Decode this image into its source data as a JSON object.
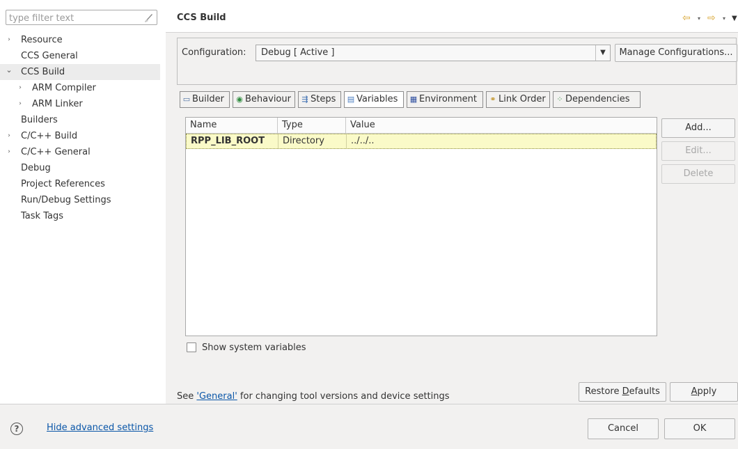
{
  "nav": {
    "filter_placeholder": "type filter text",
    "items": [
      {
        "label": "Resource",
        "expandable": true,
        "indent": 0
      },
      {
        "label": "CCS General",
        "expandable": false,
        "indent": 0
      },
      {
        "label": "CCS Build",
        "expandable": true,
        "expanded": true,
        "selected": true,
        "indent": 0
      },
      {
        "label": "ARM Compiler",
        "expandable": true,
        "indent": 1
      },
      {
        "label": "ARM Linker",
        "expandable": true,
        "indent": 1
      },
      {
        "label": "Builders",
        "expandable": false,
        "indent": 0
      },
      {
        "label": "C/C++ Build",
        "expandable": true,
        "indent": 0
      },
      {
        "label": "C/C++ General",
        "expandable": true,
        "indent": 0
      },
      {
        "label": "Debug",
        "expandable": false,
        "indent": 0
      },
      {
        "label": "Project References",
        "expandable": false,
        "indent": 0
      },
      {
        "label": "Run/Debug Settings",
        "expandable": false,
        "indent": 0
      },
      {
        "label": "Task Tags",
        "expandable": false,
        "indent": 0
      }
    ]
  },
  "header": {
    "title": "CCS Build"
  },
  "config": {
    "label": "Configuration:",
    "value": "Debug [ Active ]",
    "manage_label": "Manage Configurations..."
  },
  "tabs": [
    {
      "label": "Builder",
      "icon": "builder-icon",
      "active": false
    },
    {
      "label": "Behaviour",
      "icon": "behaviour-icon",
      "active": false
    },
    {
      "label": "Steps",
      "icon": "steps-icon",
      "active": false
    },
    {
      "label": "Variables",
      "icon": "variables-icon",
      "active": true
    },
    {
      "label": "Environment",
      "icon": "environment-icon",
      "active": false
    },
    {
      "label": "Link Order",
      "icon": "link-order-icon",
      "active": false
    },
    {
      "label": "Dependencies",
      "icon": "dependencies-icon",
      "active": false
    }
  ],
  "table": {
    "columns": [
      "Name",
      "Type",
      "Value"
    ],
    "rows": [
      {
        "name": "RPP_LIB_ROOT",
        "type": "Directory",
        "value": "../../.."
      }
    ]
  },
  "side_buttons": {
    "add": "Add...",
    "edit": "Edit...",
    "delete": "Delete"
  },
  "show_system_vars": {
    "label": "Show system variables",
    "checked": false
  },
  "footer": {
    "see_prefix": "See ",
    "see_link": "'General'",
    "see_suffix": " for changing tool versions and device settings",
    "restore_pre": "Restore ",
    "restore_mn": "D",
    "restore_post": "efaults",
    "apply_mn": "A",
    "apply_post": "pply"
  },
  "bottom": {
    "hide_advanced": "Hide advanced settings",
    "cancel": "Cancel",
    "ok": "OK"
  },
  "colors": {
    "accent": "#d8a531",
    "link": "#0a56a8",
    "selected_row": "#fafac8"
  }
}
